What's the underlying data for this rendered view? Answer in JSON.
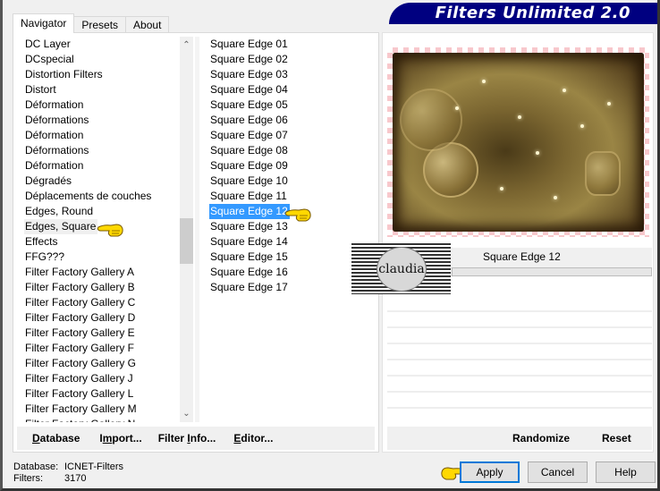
{
  "window": {
    "title": "Filters Unlimited 2.0"
  },
  "tabs": [
    {
      "label": "Navigator",
      "active": true
    },
    {
      "label": "Presets",
      "active": false
    },
    {
      "label": "About",
      "active": false
    }
  ],
  "categories": {
    "items": [
      "DC Layer",
      "DCspecial",
      "Distortion Filters",
      "Distort",
      "Déformation",
      "Déformations",
      "Déformation",
      "Déformations",
      "Déformation",
      "Dégradés",
      "Déplacements de couches",
      "Edges, Round",
      "Edges, Square",
      "Effects",
      "FFG???",
      "Filter Factory Gallery A",
      "Filter Factory Gallery B",
      "Filter Factory Gallery C",
      "Filter Factory Gallery D",
      "Filter Factory Gallery E",
      "Filter Factory Gallery F",
      "Filter Factory Gallery G",
      "Filter Factory Gallery J",
      "Filter Factory Gallery L",
      "Filter Factory Gallery M",
      "Filter Factory Gallery N"
    ],
    "selected": "Edges, Square",
    "scroll_position_fraction": 0.48
  },
  "filters": {
    "items": [
      "Square Edge 01",
      "Square Edge 02",
      "Square Edge 03",
      "Square Edge 04",
      "Square Edge 05",
      "Square Edge 06",
      "Square Edge 07",
      "Square Edge 08",
      "Square Edge 09",
      "Square Edge 10",
      "Square Edge 11",
      "Square Edge 12",
      "Square Edge 13",
      "Square Edge 14",
      "Square Edge 15",
      "Square Edge 16",
      "Square Edge 17"
    ],
    "selected": "Square Edge 12"
  },
  "preview": {
    "filter_name": "Square Edge 12",
    "watermark": "claudia"
  },
  "left_buttons": {
    "database": {
      "label": "Database",
      "mnemonic": "D"
    },
    "import": {
      "label": "Import...",
      "mnemonic": "m"
    },
    "filter_info": {
      "label": "Filter Info...",
      "mnemonic": "I"
    },
    "editor": {
      "label": "Editor...",
      "mnemonic": "E"
    }
  },
  "right_buttons": {
    "randomize": "Randomize",
    "reset": "Reset"
  },
  "status": {
    "database_label": "Database:",
    "database_value": "ICNET-Filters",
    "filters_label": "Filters:",
    "filters_value": "3170"
  },
  "dialog_buttons": {
    "apply": "Apply",
    "cancel": "Cancel",
    "help": "Help"
  },
  "colors": {
    "title_banner": "#000080",
    "selection": "#3399ff",
    "default_button_border": "#0078d7"
  }
}
